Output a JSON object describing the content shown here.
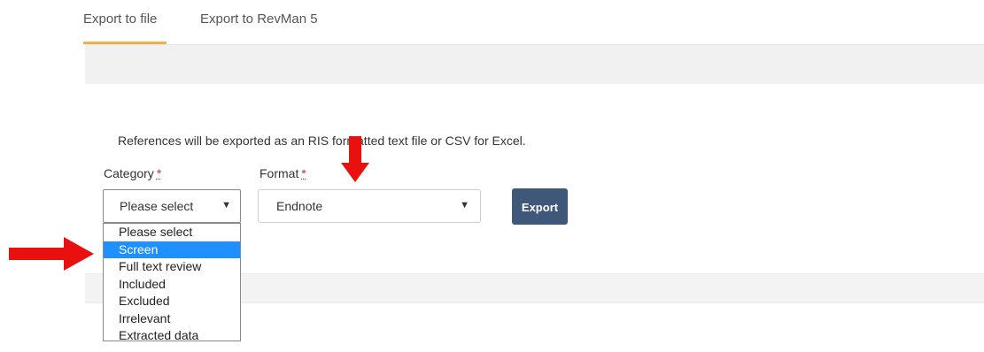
{
  "tabs": [
    {
      "label": "Export to file",
      "active": true
    },
    {
      "label": "Export to RevMan 5",
      "active": false
    }
  ],
  "description": "References will be exported as an RIS formatted text file or CSV for Excel.",
  "category": {
    "label": "Category",
    "required_mark": "*",
    "value": "Please select",
    "options": [
      "Please select",
      "Screen",
      "Full text review",
      "Included",
      "Excluded",
      "Irrelevant",
      "Extracted data"
    ],
    "highlighted_option": "Screen"
  },
  "format": {
    "label": "Format",
    "required_mark": "*",
    "value": "Endnote"
  },
  "export_button": {
    "label": "Export"
  },
  "colors": {
    "tab_underline": "#f0b04a",
    "button_bg": "#3f5778",
    "highlight": "#1e90ff",
    "annotation_arrow": "#e8110f"
  },
  "icons": {
    "select_arrow": "▼",
    "annotation_down": "red-arrow-down-icon",
    "annotation_right": "red-arrow-right-icon"
  }
}
